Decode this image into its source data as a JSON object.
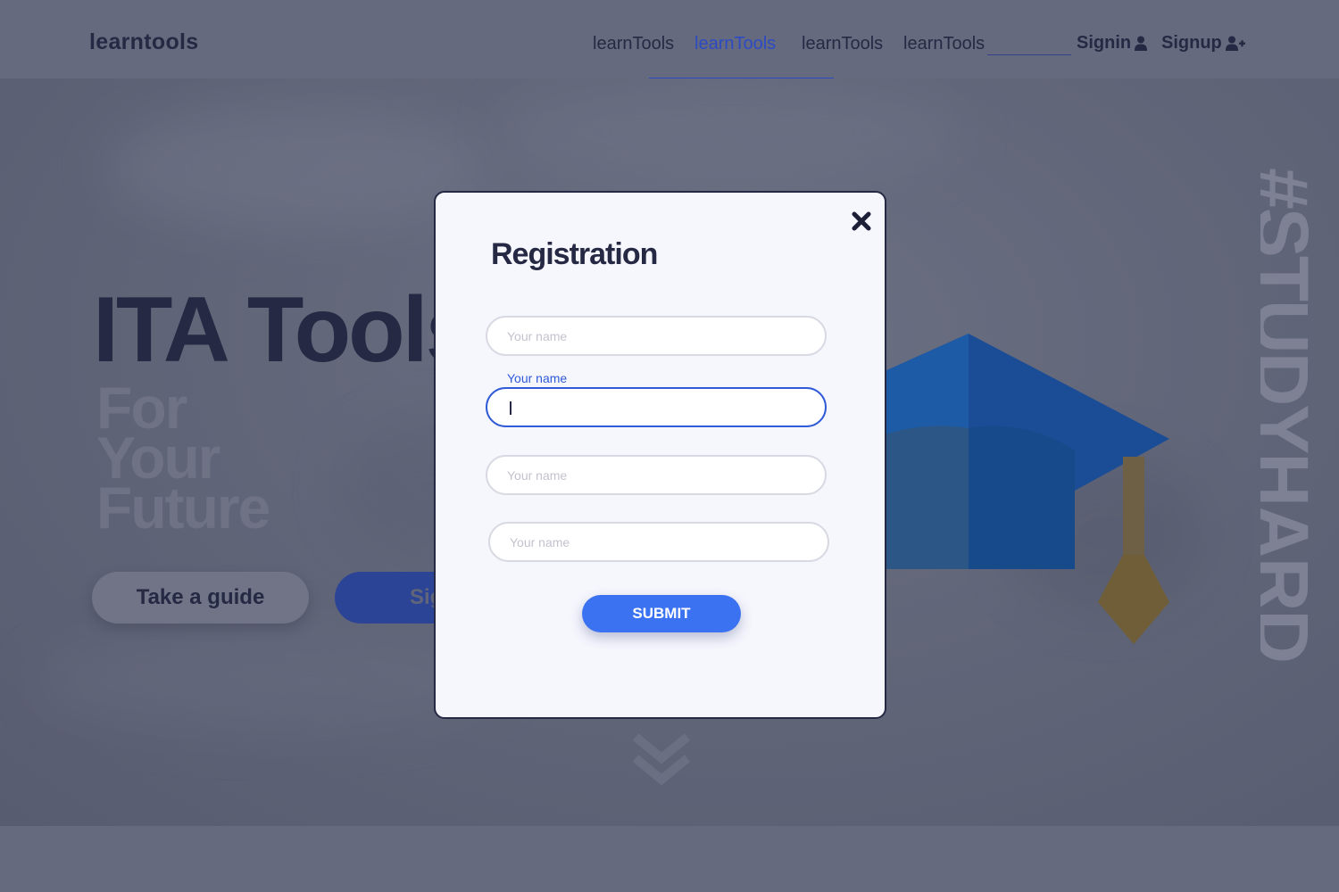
{
  "navbar": {
    "brand": "learntools",
    "links": [
      {
        "label": "learnTools",
        "active": false
      },
      {
        "label": "learnTools",
        "active": true
      },
      {
        "label": "learnTools",
        "active": false
      },
      {
        "label": "learnTools",
        "active": false
      }
    ],
    "search_value": "",
    "signin_label": "Signin",
    "signin_icon": "user-icon",
    "signup_label": "Signup",
    "signup_icon": "user-plus-icon"
  },
  "hero": {
    "title": "ITA Tools",
    "subtitle_lines": [
      "For",
      "Your",
      "Future"
    ],
    "guide_button": "Take a guide",
    "signup_button": "Sig",
    "vertical_tag": "#STUDYHARD",
    "scroll_icon": "double-chevron-down-icon"
  },
  "modal": {
    "title": "Registration",
    "close_icon": "close-icon",
    "fields": [
      {
        "placeholder": "Your name",
        "value": "",
        "focused": false
      },
      {
        "placeholder": "",
        "label": "Your name",
        "value": "",
        "focused": true
      },
      {
        "placeholder": "Your name",
        "value": "",
        "focused": false
      },
      {
        "placeholder": "Your name",
        "value": "",
        "focused": false
      }
    ],
    "submit_label": "SUBMIT"
  },
  "colors": {
    "accent": "#3b72f2",
    "nav_active": "#2c4bc2",
    "text_dark": "#262943",
    "cap_blue": "#1b4d96",
    "tassel": "#7a6a3a"
  }
}
